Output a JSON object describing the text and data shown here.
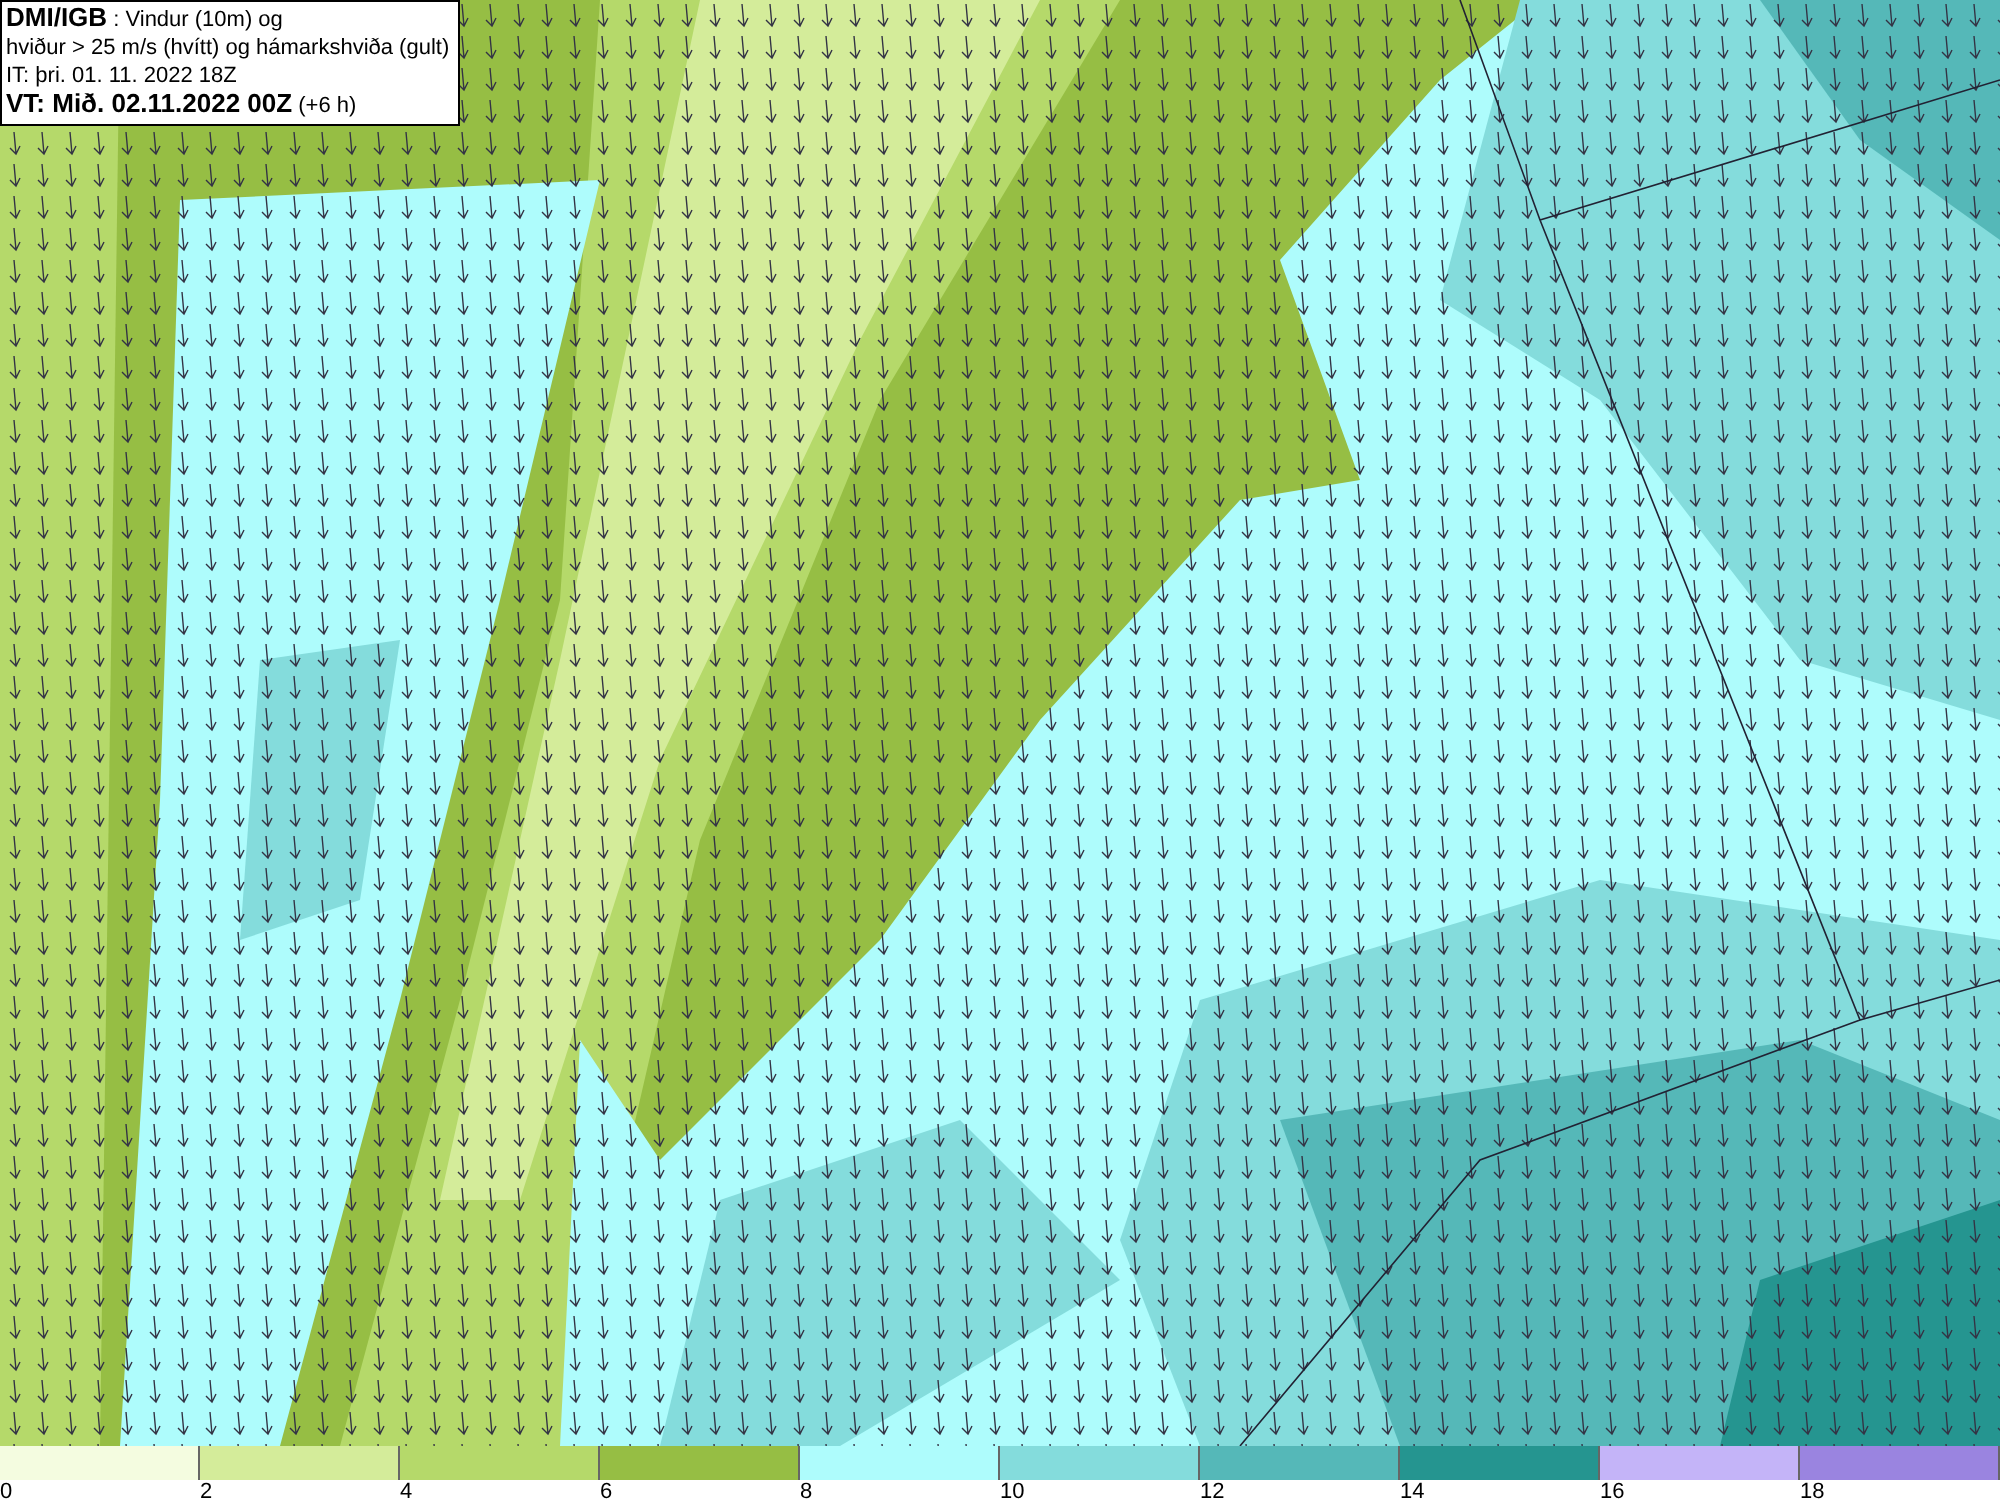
{
  "title_box": {
    "lines": [
      "**DMI/IGB** : Vindur (10m) og",
      "hviður > 25 m/s (hvítt) og hámarkshviða (gult)",
      "IT: þri. 01. 11. 2022 18Z",
      "**VT: Mið. 02.11.2022 00Z** (+6 h)"
    ]
  },
  "legend": [
    {
      "label": "0",
      "color": "#f4fce0"
    },
    {
      "label": "2",
      "color": "#d4ec9a"
    },
    {
      "label": "4",
      "color": "#b5d96a"
    },
    {
      "label": "6",
      "color": "#96be44"
    },
    {
      "label": "8",
      "color": "#aefcfc"
    },
    {
      "label": "10",
      "color": "#84dcdc"
    },
    {
      "label": "12",
      "color": "#55b8b8"
    },
    {
      "label": "14",
      "color": "#259590"
    },
    {
      "label": "16",
      "color": "#c4b4f8"
    },
    {
      "label": "18",
      "color": "#9a84e0"
    }
  ]
}
